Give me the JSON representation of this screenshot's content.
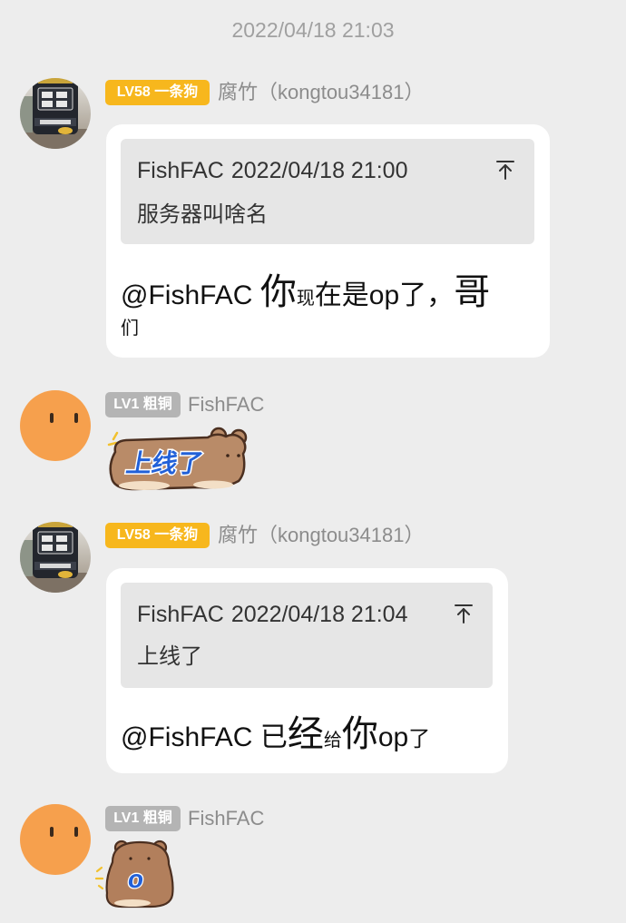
{
  "timestamp": "2022/04/18 21:03",
  "colors": {
    "background": "#ededed",
    "badge_gold": "#f7b71d",
    "badge_gray": "#b4b4b4",
    "orange_avatar": "#f6a04d",
    "sticker_text_blue": "#2160d8"
  },
  "messages": [
    {
      "sender": {
        "name": "腐竹（kongtou34181）",
        "badge": "LV58 一条狗",
        "avatar": "photo-avatar"
      },
      "quote": {
        "author": "FishFAC",
        "time": "2022/04/18 21:00",
        "text": "服务器叫啥名",
        "icon": "arrow-up-bar-icon"
      },
      "segments": [
        "@FishFAC ",
        "你",
        "现",
        "在是op了，",
        "哥",
        "们"
      ]
    },
    {
      "sender": {
        "name": "FishFAC",
        "badge": "LV1 粗铜",
        "avatar": "orange-face-avatar"
      },
      "sticker": {
        "text": "上线了",
        "icon": "brown-bear-sticker"
      }
    },
    {
      "sender": {
        "name": "腐竹（kongtou34181）",
        "badge": "LV58 一条狗",
        "avatar": "photo-avatar"
      },
      "quote": {
        "author": "FishFAC",
        "time": "2022/04/18 21:04",
        "text": "上线了",
        "icon": "arrow-up-bar-icon"
      },
      "segments": [
        "@FishFAC ",
        "已",
        "经",
        "给",
        "你",
        "op",
        "了"
      ]
    },
    {
      "sender": {
        "name": "FishFAC",
        "badge": "LV1 粗铜",
        "avatar": "orange-face-avatar"
      },
      "sticker": {
        "text": "o",
        "icon": "brown-bear-sticker"
      }
    }
  ]
}
